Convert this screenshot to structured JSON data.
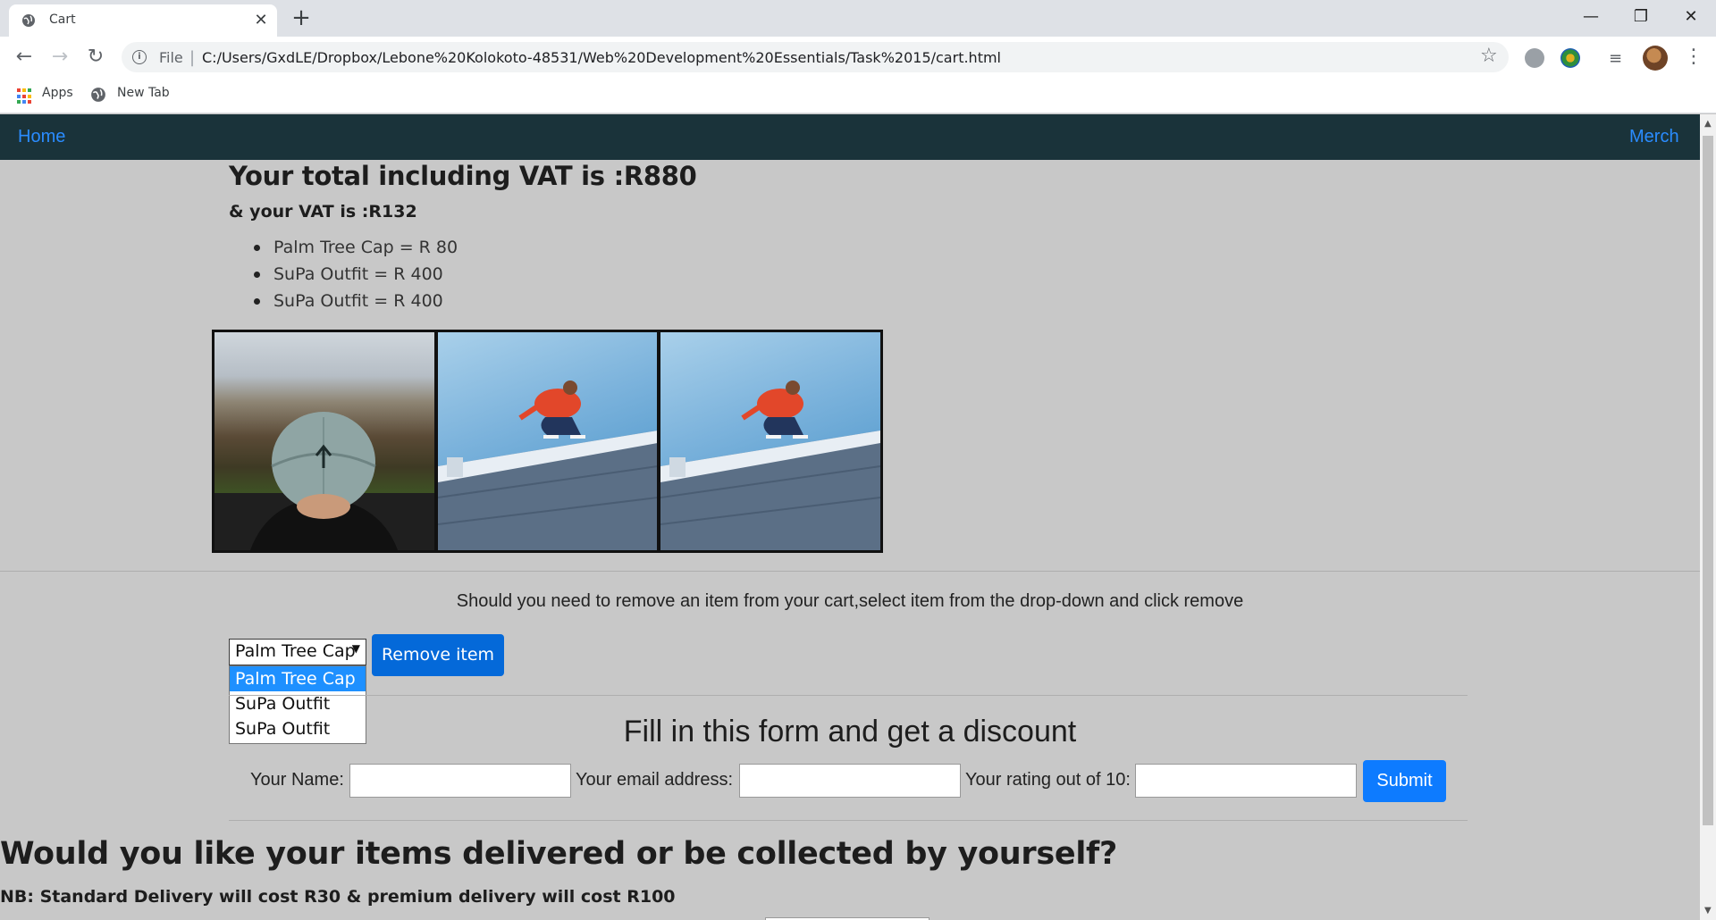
{
  "browser": {
    "tab_title": "Cart",
    "tab_close": "✕",
    "new_tab": "+",
    "scheme_label": "File",
    "url": "C:/Users/GxdLE/Dropbox/Lebone%20Kolokoto-48531/Web%20Development%20Essentials/Task%2015/cart.html",
    "bookmarks": [
      "Apps",
      "New Tab"
    ]
  },
  "navbar": {
    "home": "Home",
    "merch": "Merch"
  },
  "cart": {
    "total_text": "Your total including VAT is :R880",
    "vat_text": "& your VAT is :R132",
    "items": [
      "Palm Tree Cap = R 80",
      "SuPa Outfit = R 400",
      "SuPa Outfit = R 400"
    ]
  },
  "remove": {
    "instructions": "Should you need to remove an item from your cart,select item from the drop-down and click remove",
    "selected": "Palm Tree Cap",
    "options": [
      "Palm Tree Cap",
      "SuPa Outfit",
      "SuPa Outfit"
    ],
    "button": "Remove item"
  },
  "discount_form": {
    "title": "Fill in this form and get a discount",
    "name_label": "Your Name:",
    "email_label": "Your email address:",
    "rating_label": "Your rating out of 10:",
    "submit": "Submit"
  },
  "delivery": {
    "question": "Would you like your items delivered or be collected by yourself?",
    "note": "NB: Standard Delivery will cost R30 & premium delivery will cost R100"
  },
  "colors": {
    "navbar_bg": "#1a333a",
    "link": "#2a8cff",
    "primary_button": "#0469d9",
    "submit_button": "#0d7bff",
    "page_bg": "#c8c8c8"
  }
}
